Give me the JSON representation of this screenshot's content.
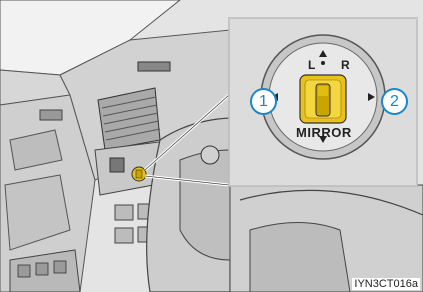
{
  "illustration": {
    "inset": {
      "label_l": "L",
      "label_r": "R",
      "label_mirror": "MIRROR",
      "callout_1": "1",
      "callout_2": "2",
      "knob_color": "#e8c21a",
      "ring_color": "#c7c7c7"
    },
    "figure_code": "IYN3CT016a",
    "colors": {
      "callout_blue": "#1b86c7",
      "panel_gray": "#d6d6d6",
      "line_dark": "#3a3a3a"
    }
  }
}
